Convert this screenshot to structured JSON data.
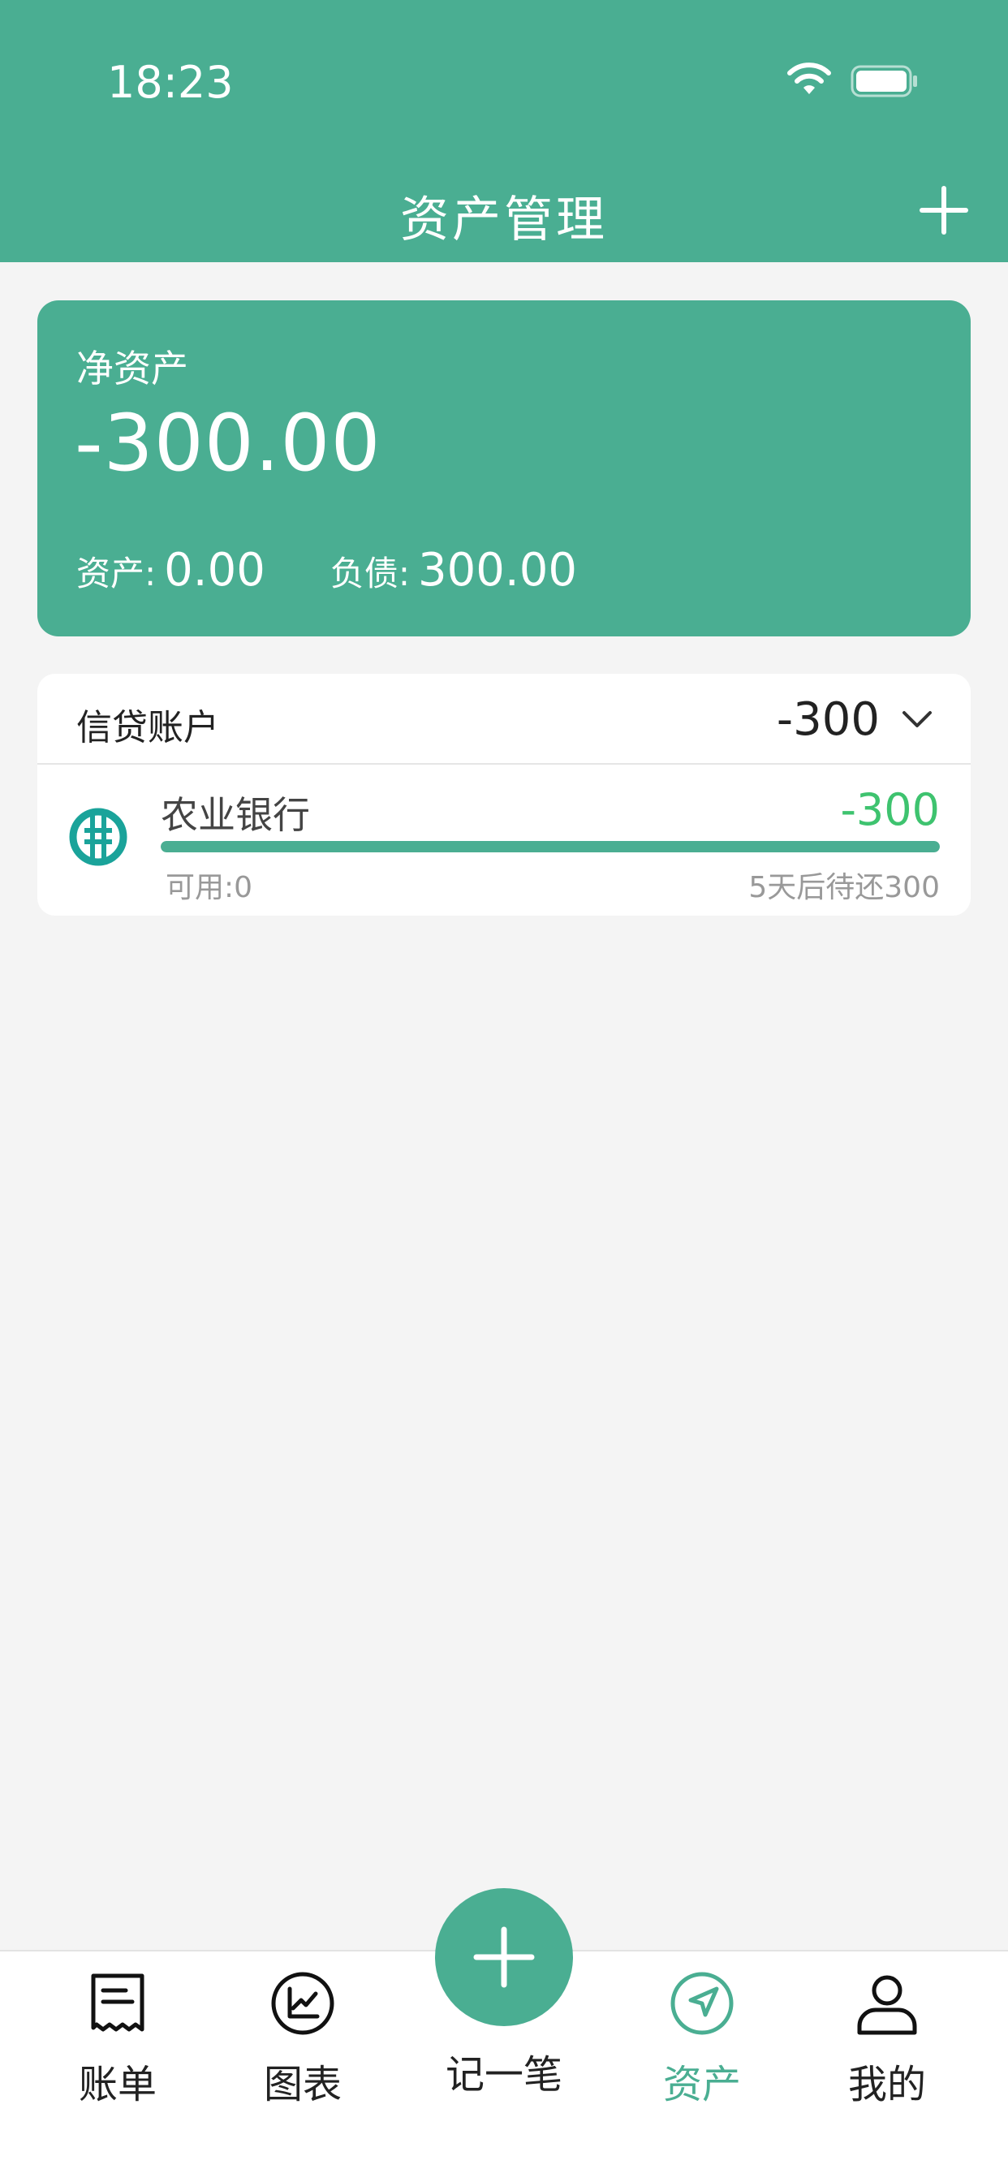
{
  "status_bar": {
    "time": "18:23"
  },
  "header": {
    "title": "资产管理",
    "add_icon": "plus-icon"
  },
  "summary": {
    "net_label": "净资产",
    "net_value": "-300.00",
    "assets_label": "资产:",
    "assets_value": "0.00",
    "debt_label": "负债:",
    "debt_value": "300.00"
  },
  "credit_group": {
    "title": "信贷账户",
    "total": "-300",
    "accounts": [
      {
        "name": "农业银行",
        "amount": "-300",
        "available": "可用:0",
        "due_text": "5天后待还300",
        "usage_fraction": 1.0,
        "icon": "abc-bank-logo-icon"
      }
    ]
  },
  "tabs": [
    {
      "label": "账单",
      "icon": "receipt-icon",
      "active": false
    },
    {
      "label": "图表",
      "icon": "chart-icon",
      "active": false
    },
    {
      "label": "记一笔",
      "icon": "plus-icon",
      "active": false
    },
    {
      "label": "资产",
      "icon": "compass-icon",
      "active": true
    },
    {
      "label": "我的",
      "icon": "person-icon",
      "active": false
    }
  ],
  "colors": {
    "brand": "#4aae92",
    "positive_amount": "#3ec36f"
  }
}
